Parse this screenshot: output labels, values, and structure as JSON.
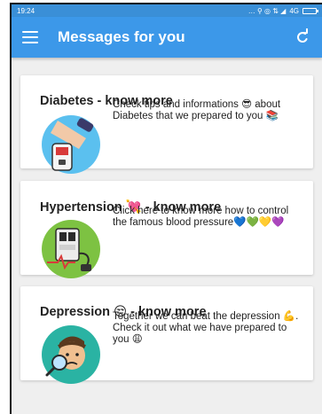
{
  "status_bar": {
    "time": "19:24",
    "network": "4G"
  },
  "app_bar": {
    "title": "Messages for you"
  },
  "cards": [
    {
      "title": "Diabetes - know more",
      "title_emoji": "",
      "body": "Check tips and informations 😎 about Diabetes that we prepared to you 📚"
    },
    {
      "title": "Hypertension",
      "title_emoji": "💘",
      "title_suffix": "- know more",
      "body": "Click here to know more how to control the famous blood pressure💙💚💛💜"
    },
    {
      "title": "Depression",
      "title_emoji": "😒",
      "title_suffix": "- know more",
      "body": "Together we can beat the depression 💪. Check it out what we have prepared to you 😩"
    }
  ],
  "colors": {
    "app_bar": "#3c98e9",
    "status_bar": "#3a8fd7",
    "diabetes_icon_bg": "#5bc0ef",
    "hypertension_icon_bg": "#7dc242",
    "depression_icon_bg": "#2ab3a3"
  }
}
